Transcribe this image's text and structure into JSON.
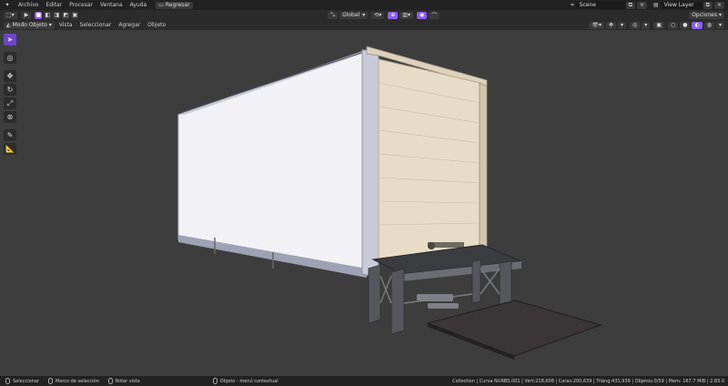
{
  "colors": {
    "accent": "#8a5cf5",
    "header": "#2b2b2b",
    "topbar": "#222222",
    "viewport": "#3d3d3d"
  },
  "menu": {
    "items": [
      "Archivo",
      "Editar",
      "Procesar",
      "Ventana",
      "Ayuda"
    ]
  },
  "regresar_label": "Regresar",
  "scene_field": "Scene",
  "view_layer_field": "View Layer",
  "orientation_label": "Global",
  "options_label": "Opciones",
  "header2": {
    "mode_label": "Modo Objeto",
    "menus": [
      "Vista",
      "Seleccionar",
      "Agregar",
      "Objeto"
    ]
  },
  "status": {
    "select_label": "Seleccionar",
    "box_select_label": "Marco de selección",
    "rotate_label": "Rotar vista",
    "context_label": "Objeto - menú contextual",
    "stats": "Collection | Curva NURBS.001 | Vért:218,608 | Caras:200,639 | Triáng:431,939 | Objetos:0/59 | Mem: 167.7 MiB | 2.83.0"
  },
  "icons": [
    "editor-type-icon",
    "play-icon",
    "select-mode-icons",
    "proportional-icon",
    "snap-icon",
    "gizmo-icon",
    "overlay-icon",
    "xray-icon",
    "shading-icons",
    "scene-icon",
    "view-layer-icon"
  ]
}
